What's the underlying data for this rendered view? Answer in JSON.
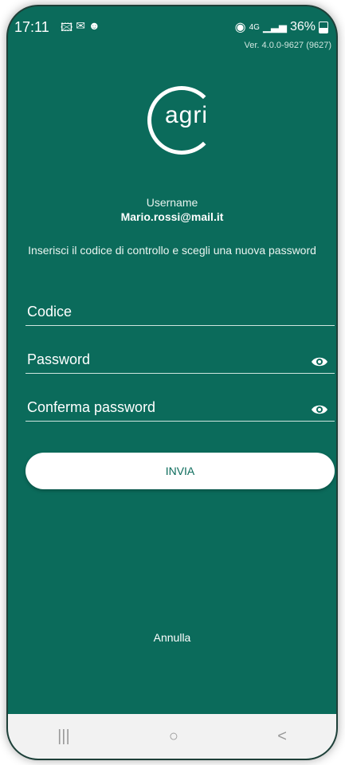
{
  "status": {
    "time": "17:11",
    "left_icons": [
      "image-icon",
      "gmail-icon",
      "app-icon"
    ],
    "network": "4G",
    "battery": "36%"
  },
  "version": "Ver. 4.0.0-9627 (9627)",
  "brand": {
    "logo_text": "agri"
  },
  "username": {
    "label": "Username",
    "value": "Mario.rossi@mail.it"
  },
  "instructions": "Inserisci il codice di controllo e scegli una nuova password",
  "form": {
    "code_label": "Codice",
    "password_label": "Password",
    "confirm_label": "Conferma password"
  },
  "actions": {
    "submit": "INVIA",
    "cancel": "Annulla"
  },
  "nav": {
    "recents": "|||",
    "home": "○",
    "back": "<"
  },
  "colors": {
    "primary": "#0b6b5b",
    "button_bg": "#ffffff"
  }
}
